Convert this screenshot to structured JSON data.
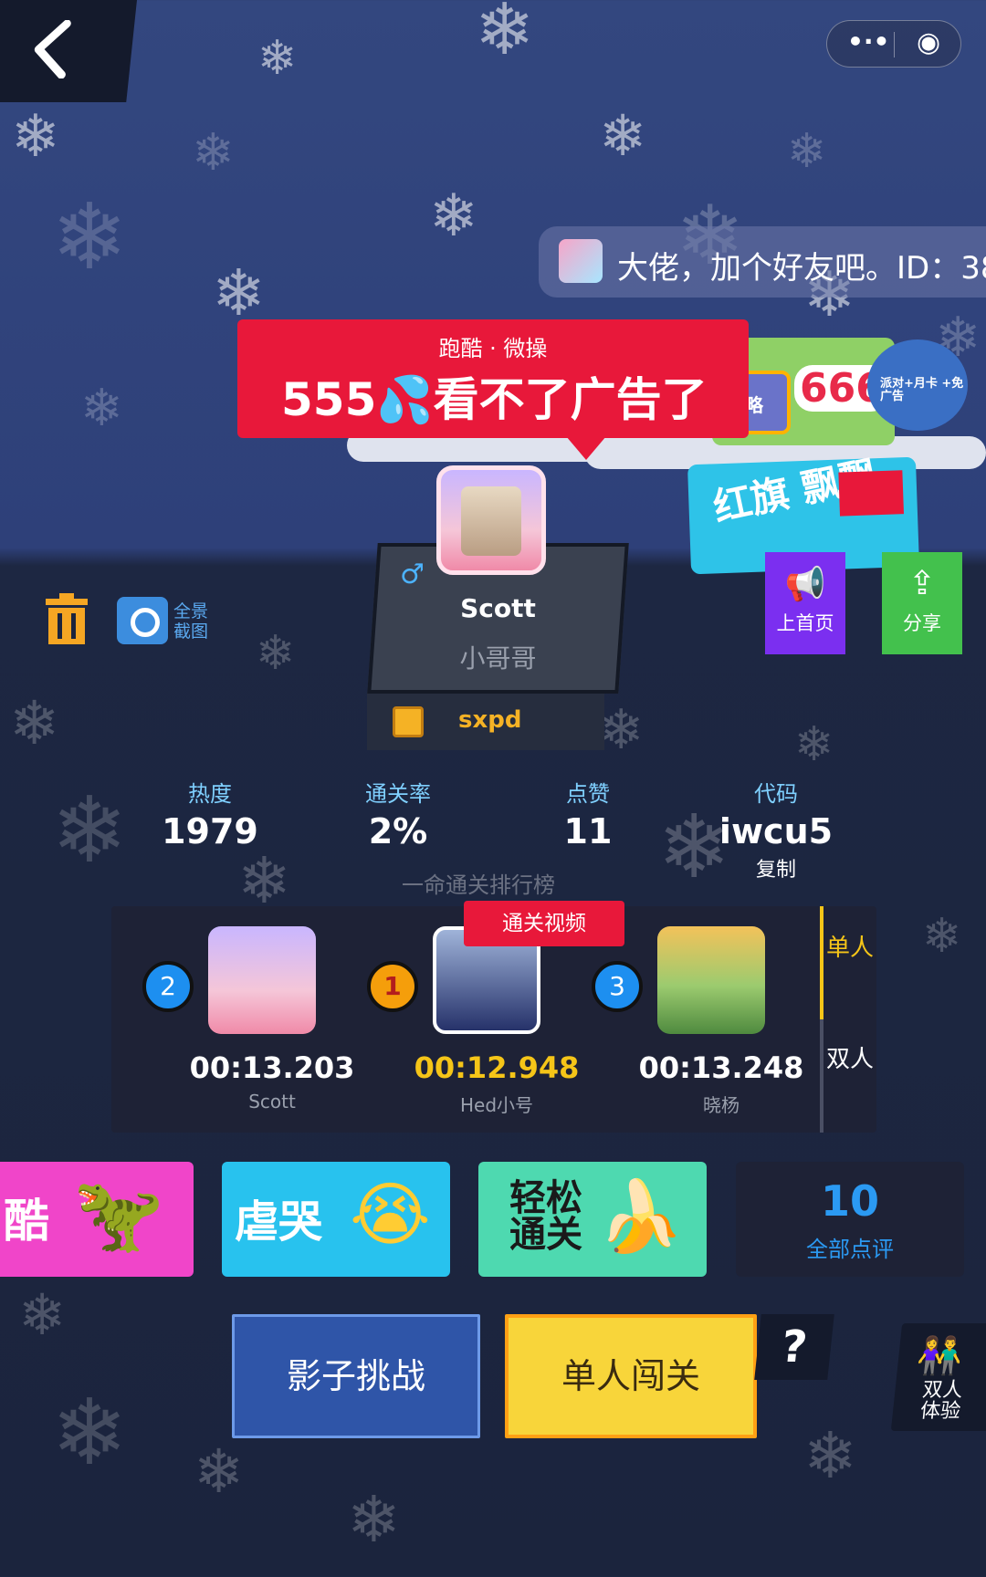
{
  "nav": {
    "back_icon": "chevron-left-icon",
    "capsule_more": "•·•",
    "capsule_close": "◉"
  },
  "chat": {
    "message": "大佬，加个好友吧。ID：38"
  },
  "level": {
    "category": "跑酷 · 微操",
    "title": "555💦看不了广告了"
  },
  "stickers": {
    "tv_label": "攻略",
    "pot_label": "666",
    "vip_label": "派对+月卡 +免广告",
    "flag_label": "红旗 飘飘"
  },
  "actions": {
    "home_label": "上首页",
    "share_label": "分享"
  },
  "tools": {
    "screenshot_label": "全景 截图"
  },
  "profile": {
    "gender": "♂",
    "name": "Scott",
    "title": "小哥哥",
    "author": "sxpd"
  },
  "stats": [
    {
      "label": "热度",
      "value": "1979"
    },
    {
      "label": "通关率",
      "value": "2%"
    },
    {
      "label": "点赞",
      "value": "11"
    },
    {
      "label": "代码",
      "value": "iwcu5"
    }
  ],
  "copy_label": "复制",
  "rank_caption": "一命通关排行榜",
  "leaderboard": {
    "video_tag": "通关视频",
    "tab_single": "单人",
    "tab_double": "双人",
    "entries": [
      {
        "rank": "2",
        "time": "00:13.203",
        "name": "Scott"
      },
      {
        "rank": "1",
        "time": "00:12.948",
        "name": "Hed小号"
      },
      {
        "rank": "3",
        "time": "00:13.248",
        "name": "晓杨"
      }
    ]
  },
  "reviews": {
    "tags": [
      "酷",
      "虐哭",
      "轻松 通关"
    ],
    "count": "10",
    "all_label": "全部点评"
  },
  "buttons": {
    "shadow": "影子挑战",
    "single": "单人闯关",
    "help": "?",
    "duo": "双人 体验"
  }
}
